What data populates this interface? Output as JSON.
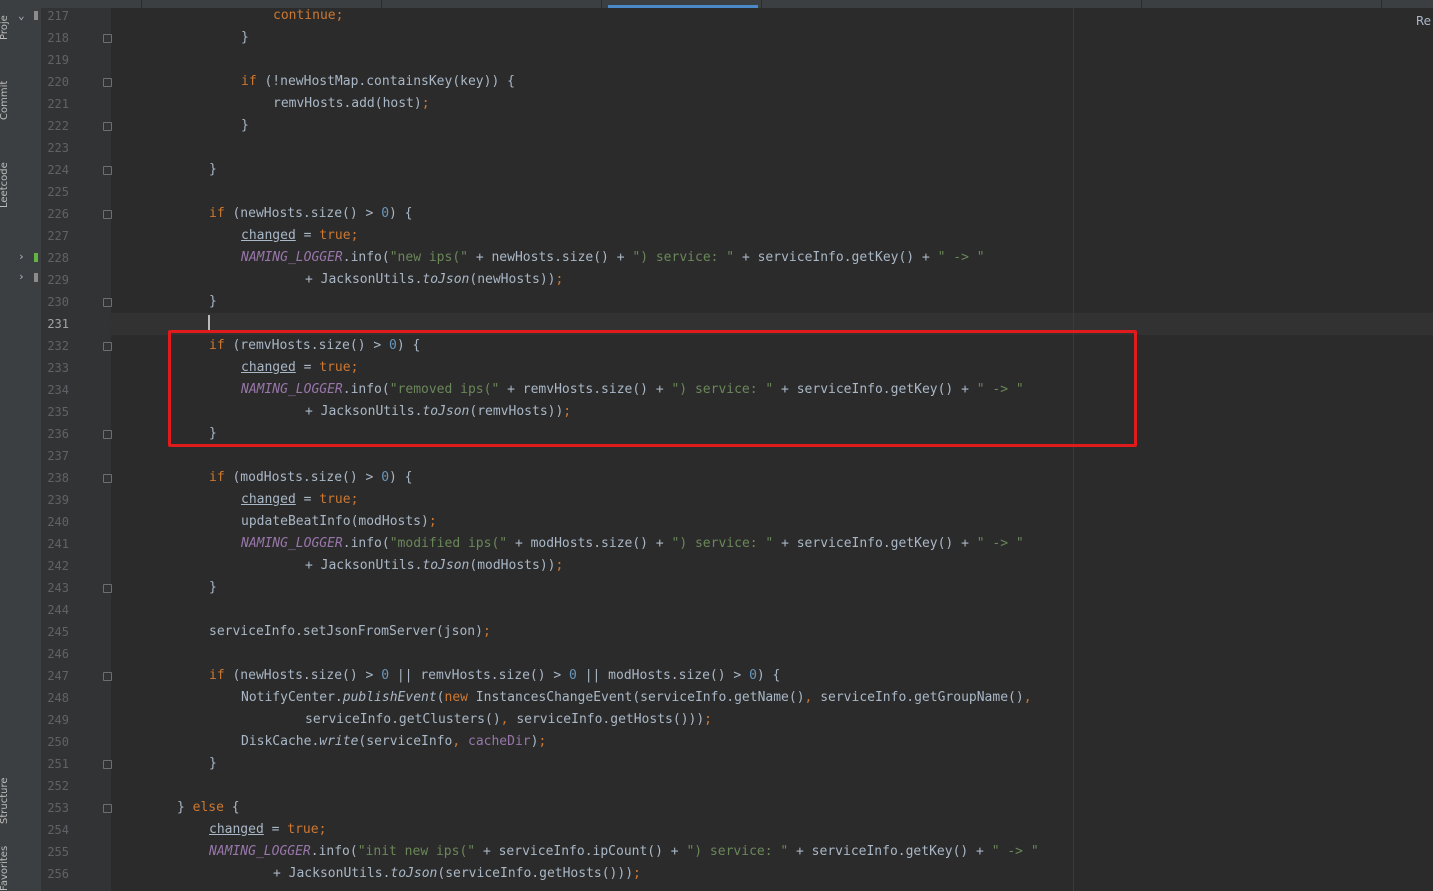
{
  "sidebar": {
    "project_label": "Proje",
    "commit_label": "Commit",
    "leetcode_label": "Leetcode",
    "structure_label": "Structure",
    "favorites_label": "Favorites"
  },
  "editor": {
    "reader_mode_hint": "Re",
    "current_line": 231,
    "highlight_box_color": "#e11b1b",
    "line_numbers": [
      217,
      218,
      219,
      220,
      221,
      222,
      223,
      224,
      225,
      226,
      227,
      228,
      229,
      230,
      231,
      232,
      233,
      234,
      235,
      236,
      237,
      238,
      239,
      240,
      241,
      242,
      243,
      244,
      245,
      246,
      247,
      248,
      249,
      250,
      251,
      252,
      253,
      254,
      255,
      256
    ],
    "code": {
      "l217": {
        "kw": "continue",
        "p": ";"
      },
      "l218": {
        "b": "}"
      },
      "l220": {
        "kw": "if",
        "t1": " (!newHostMap.containsKey(key)) {"
      },
      "l221": {
        "t1": "remvHosts.add(host)",
        "p": ";"
      },
      "l222": {
        "b": "}"
      },
      "l224": {
        "b": "}"
      },
      "l226": {
        "kw": "if",
        "t1": " (newHosts.size() > ",
        "n": "0",
        "t2": ") {"
      },
      "l227": {
        "v": "changed",
        "t1": " = ",
        "kw": "true",
        "p": ";"
      },
      "l228": {
        "c": "NAMING_LOGGER",
        "t1": ".info(",
        "s1": "\"new ips(\"",
        "t2": " + newHosts.size() + ",
        "s2": "\") service: \"",
        "t3": " + serviceInfo.getKey() + ",
        "s3": "\" -> \""
      },
      "l229": {
        "t1": "+ JacksonUtils.",
        "i": "toJson",
        "t2": "(newHosts))",
        "p": ";"
      },
      "l230": {
        "b": "}"
      },
      "l232": {
        "kw": "if",
        "t1": " (remvHosts.size() > ",
        "n": "0",
        "t2": ") {"
      },
      "l233": {
        "v": "changed",
        "t1": " = ",
        "kw": "true",
        "p": ";"
      },
      "l234": {
        "c": "NAMING_LOGGER",
        "t1": ".info(",
        "s1": "\"removed ips(\"",
        "t2": " + remvHosts.size() + ",
        "s2": "\") service: \"",
        "t3": " + serviceInfo.getKey() + ",
        "s3": "\" -> \""
      },
      "l235": {
        "t1": "+ JacksonUtils.",
        "i": "toJson",
        "t2": "(remvHosts))",
        "p": ";"
      },
      "l236": {
        "b": "}"
      },
      "l238": {
        "kw": "if",
        "t1": " (modHosts.size() > ",
        "n": "0",
        "t2": ") {"
      },
      "l239": {
        "v": "changed",
        "t1": " = ",
        "kw": "true",
        "p": ";"
      },
      "l240": {
        "t1": "updateBeatInfo(modHosts)",
        "p": ";"
      },
      "l241": {
        "c": "NAMING_LOGGER",
        "t1": ".info(",
        "s1": "\"modified ips(\"",
        "t2": " + modHosts.size() + ",
        "s2": "\") service: \"",
        "t3": " + serviceInfo.getKey() + ",
        "s3": "\" -> \""
      },
      "l242": {
        "t1": "+ JacksonUtils.",
        "i": "toJson",
        "t2": "(modHosts))",
        "p": ";"
      },
      "l243": {
        "b": "}"
      },
      "l245": {
        "t1": "serviceInfo.setJsonFromServer(json)",
        "p": ";"
      },
      "l247": {
        "kw": "if",
        "t1": " (newHosts.size() > ",
        "n1": "0",
        "t2": " || remvHosts.size() > ",
        "n2": "0",
        "t3": " || modHosts.size() > ",
        "n3": "0",
        "t4": ") {"
      },
      "l248": {
        "t1": "NotifyCenter.",
        "i": "publishEvent",
        "t2": "(",
        "kw": "new",
        "t3": " InstancesChangeEvent(serviceInfo.getName()",
        "p1": ", ",
        "t4": "serviceInfo.getGroupName()",
        "p2": ","
      },
      "l249": {
        "t1": "serviceInfo.getClusters()",
        "p1": ", ",
        "t2": "serviceInfo.getHosts()))",
        "p": ";"
      },
      "l250": {
        "t1": "DiskCache.",
        "i": "write",
        "t2": "(serviceInfo",
        "p1": ", ",
        "f": "cacheDir",
        "t3": ")",
        "p": ";"
      },
      "l251": {
        "b": "}"
      },
      "l253": {
        "b": "}",
        "kw": " else ",
        "t1": "{"
      },
      "l254": {
        "v": "changed",
        "t1": " = ",
        "kw": "true",
        "p": ";"
      },
      "l255": {
        "c": "NAMING_LOGGER",
        "t1": ".info(",
        "s1": "\"init new ips(\"",
        "t2": " + serviceInfo.ipCount() + ",
        "s2": "\") service: \"",
        "t3": " + serviceInfo.getKey() + ",
        "s3": "\" -> \""
      },
      "l256": {
        "t1": "+ JacksonUtils.",
        "i": "toJson",
        "t2": "(serviceInfo.getHosts()))",
        "p": ";"
      }
    }
  }
}
